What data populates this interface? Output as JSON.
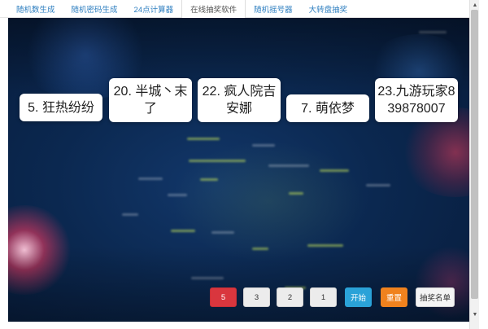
{
  "tabs": [
    {
      "label": "随机数生成"
    },
    {
      "label": "随机密码生成"
    },
    {
      "label": "24点计算器"
    },
    {
      "label": "在线抽奖软件"
    },
    {
      "label": "随机摇号器"
    },
    {
      "label": "大转盘抽奖"
    }
  ],
  "winners": [
    {
      "label": "5. 狂热纷纷"
    },
    {
      "label": "20. 半城丶末了"
    },
    {
      "label": "22. 疯人院吉安娜"
    },
    {
      "label": "7. 萌依梦"
    },
    {
      "label": "23.九游玩家839878007"
    }
  ],
  "controls": {
    "counts": [
      "5",
      "3",
      "2",
      "1"
    ],
    "start_label": "开始",
    "reset_label": "重置",
    "list_label": "抽奖名单"
  },
  "scrollbar": {
    "up": "▲",
    "down": "▼"
  },
  "colors": {
    "active": "#d9363e",
    "start": "#2aa2d8",
    "reset": "#f0821e",
    "link": "#2f7fc0"
  }
}
